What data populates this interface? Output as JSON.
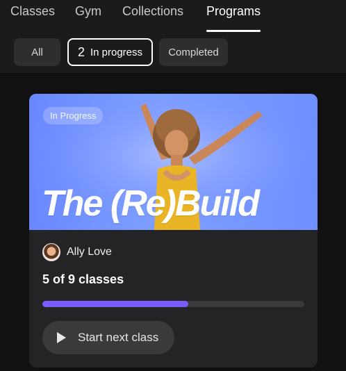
{
  "nav": {
    "tabs": [
      {
        "label": "Classes",
        "active": false
      },
      {
        "label": "Gym",
        "active": false
      },
      {
        "label": "Collections",
        "active": false
      },
      {
        "label": "Programs",
        "active": true
      }
    ]
  },
  "filters": {
    "all_label": "All",
    "in_progress_count": "2",
    "in_progress_label": "In progress",
    "completed_label": "Completed",
    "selected": "In progress"
  },
  "program": {
    "badge": "In Progress",
    "title": "The (Re)Build",
    "instructor": "Ally Love",
    "classes_done": 5,
    "classes_total": 9,
    "classes_text": "5 of 9 classes",
    "progress_fraction": 0.556,
    "start_label": "Start next class"
  },
  "colors": {
    "accent_progress": "#7a5cff",
    "hero_blue": "#7a98ff",
    "background": "#111112"
  },
  "icons": {
    "play": "play-icon",
    "avatar": "instructor-avatar"
  }
}
